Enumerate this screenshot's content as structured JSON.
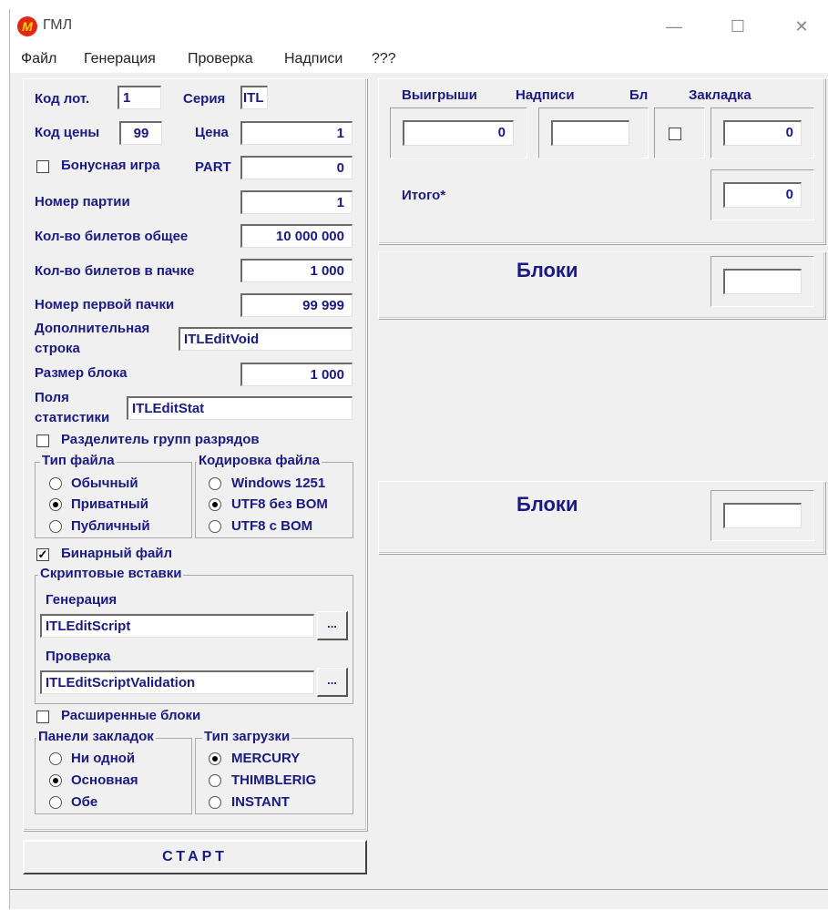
{
  "window": {
    "title": "ГМЛ",
    "logo_letter": "M"
  },
  "menu": [
    "Файл",
    "Генерация",
    "Проверка",
    "Надписи",
    "???"
  ],
  "form": {
    "kod_lot_label": "Код лот.",
    "kod_lot_value": "1",
    "seriya_label": "Серия",
    "seriya_value": "ITL",
    "kod_ceny_label": "Код цены",
    "kod_ceny_value": "99",
    "cena_label": "Цена",
    "cena_value": "1",
    "bonus_label": "Бонусная игра",
    "part_label": "PART",
    "part_value": "0",
    "nomer_partii_label": "Номер партии",
    "nomer_partii_value": "1",
    "bilety_obshee_label": "Кол-во билетов общее",
    "bilety_obshee_value": "10 000 000",
    "bilety_pachka_label": "Кол-во билетов в пачке",
    "bilety_pachka_value": "1 000",
    "pervaya_pachka_label": "Номер первой пачки",
    "pervaya_pachka_value": "99 999",
    "dop_stroka_label": "Дополнительная строка",
    "dop_stroka_value": "ITLEditVoid",
    "razmer_bloka_label": "Размер блока",
    "razmer_bloka_value": "1 000",
    "polya_stat_label": "Поля статистики",
    "polya_stat_value": "ITLEditStat",
    "razdelitel_label": "Разделитель групп разрядов",
    "binary_label": "Бинарный файл",
    "extended_blocks_label": "Расширенные блоки",
    "start_label": "СТАРТ"
  },
  "file_type": {
    "title": "Тип файла",
    "options": [
      "Обычный",
      "Приватный",
      "Публичный"
    ],
    "selected": 1
  },
  "encoding": {
    "title": "Кодировка файла",
    "options": [
      "Windows 1251",
      "UTF8 без BOM",
      "UTF8 с BOM"
    ],
    "selected": 1
  },
  "scripts": {
    "title": "Скриптовые вставки",
    "gen_label": "Генерация",
    "gen_value": "ITLEditScript",
    "check_label": "Проверка",
    "check_value": "ITLEditScriptValidation",
    "browse_label": "..."
  },
  "bookmarks": {
    "title": "Панели закладок",
    "options": [
      "Ни одной",
      "Основная",
      "Обе"
    ],
    "selected": 1
  },
  "load_type": {
    "title": "Тип загрузки",
    "options": [
      "MERCURY",
      "THIMBLERIG",
      "INSTANT"
    ],
    "selected": 0
  },
  "right": {
    "wins_label": "Выигрыши",
    "wins_value": "0",
    "nadpisi_label": "Надписи",
    "nadpisi_value": "",
    "bl_label": "Бл",
    "zakladka_label": "Закладка",
    "zakladka_value": "0",
    "itogo_label": "Итого*",
    "itogo_value": "0",
    "blocks1_label": "Блоки",
    "blocks1_value": "",
    "blocks2_label": "Блоки",
    "blocks2_value": ""
  }
}
